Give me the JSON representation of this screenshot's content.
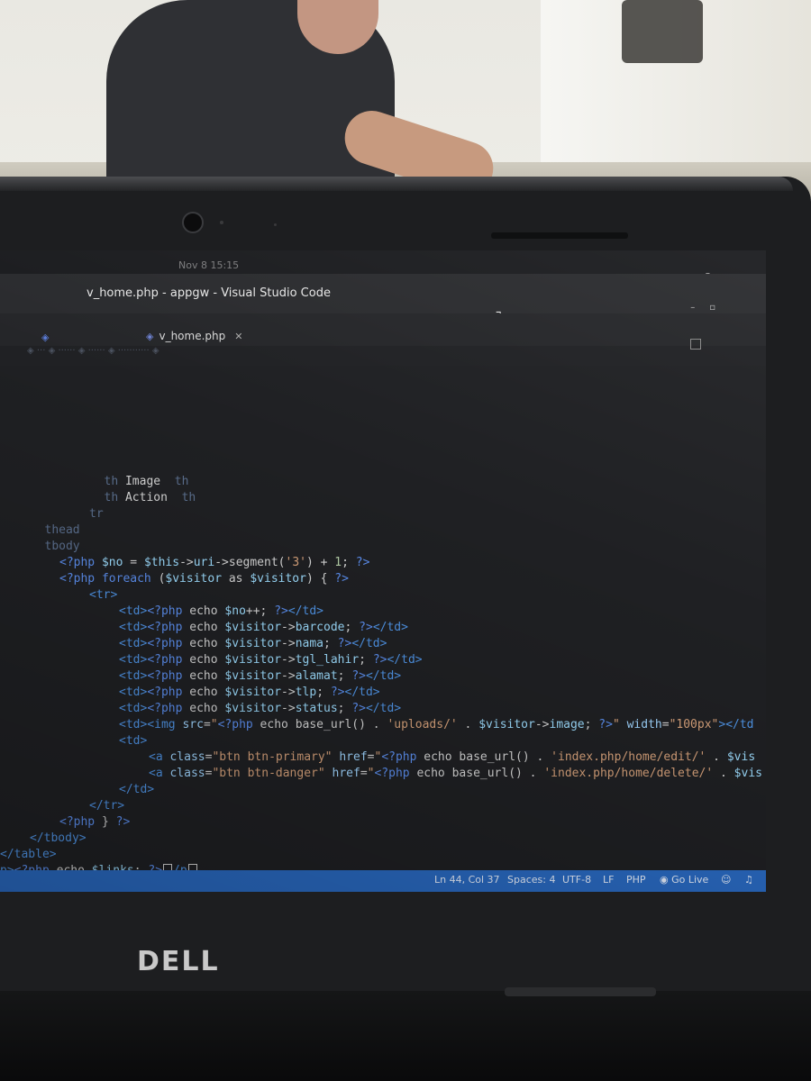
{
  "system": {
    "clock": "Nov 8  15:15",
    "tray_icons": [
      "wifi-icon",
      "volume-icon",
      "battery-icon",
      "chevron-down-icon"
    ]
  },
  "window": {
    "title": "v_home.php - appgw - Visual Studio Code",
    "controls": [
      "minimize",
      "maximize",
      "close"
    ]
  },
  "tabs": [
    {
      "label": "v_home.php",
      "icon": "php-file-icon",
      "active": true
    }
  ],
  "editor": {
    "lines": [
      {
        "indent": 7,
        "html": "<span class='t-dim'>th</span> Image  <span class='t-dim'>th</span>"
      },
      {
        "indent": 7,
        "html": "<span class='t-dim'>th</span> Action  <span class='t-dim'>th</span>"
      },
      {
        "indent": 6,
        "html": "<span class='t-dim'>tr</span>"
      },
      {
        "indent": 3,
        "html": "<span class='t-dim'>thead</span>"
      },
      {
        "indent": 3,
        "html": "<span class='t-dim'>tbody</span>"
      },
      {
        "indent": 4,
        "html": "<span class='t-php'>&lt;?php</span> <span class='t-var'>$no</span> = <span class='t-var'>$this</span>-&gt;<span class='t-var'>uri</span>-&gt;segment(<span class='t-str'>'3'</span>) + <span class='t-num'>1</span>; <span class='t-php'>?&gt;</span>"
      },
      {
        "indent": 4,
        "html": "<span class='t-php'>&lt;?php foreach</span> (<span class='t-var'>$visitor</span> as <span class='t-var'>$visitor</span>) { <span class='t-php'>?&gt;</span>"
      },
      {
        "indent": 6,
        "html": "<span class='t-tag'>&lt;tr&gt;</span>"
      },
      {
        "indent": 8,
        "html": "<span class='t-tag'>&lt;td&gt;</span><span class='t-php'>&lt;?php</span> echo <span class='t-var'>$no</span>++; <span class='t-php'>?&gt;</span><span class='t-tag'>&lt;/td&gt;</span>"
      },
      {
        "indent": 8,
        "html": "<span class='t-tag'>&lt;td&gt;</span><span class='t-php'>&lt;?php</span> echo <span class='t-var'>$visitor</span>-&gt;<span class='t-var'>barcode</span>; <span class='t-php'>?&gt;</span><span class='t-tag'>&lt;/td&gt;</span>"
      },
      {
        "indent": 8,
        "html": "<span class='t-tag'>&lt;td&gt;</span><span class='t-php'>&lt;?php</span> echo <span class='t-var'>$visitor</span>-&gt;<span class='t-var'>nama</span>; <span class='t-php'>?&gt;</span><span class='t-tag'>&lt;/td&gt;</span>"
      },
      {
        "indent": 8,
        "html": "<span class='t-tag'>&lt;td&gt;</span><span class='t-php'>&lt;?php</span> echo <span class='t-var'>$visitor</span>-&gt;<span class='t-var'>tgl_lahir</span>; <span class='t-php'>?&gt;</span><span class='t-tag'>&lt;/td&gt;</span>"
      },
      {
        "indent": 8,
        "html": "<span class='t-tag'>&lt;td&gt;</span><span class='t-php'>&lt;?php</span> echo <span class='t-var'>$visitor</span>-&gt;<span class='t-var'>alamat</span>; <span class='t-php'>?&gt;</span><span class='t-tag'>&lt;/td&gt;</span>"
      },
      {
        "indent": 8,
        "html": "<span class='t-tag'>&lt;td&gt;</span><span class='t-php'>&lt;?php</span> echo <span class='t-var'>$visitor</span>-&gt;<span class='t-var'>tlp</span>; <span class='t-php'>?&gt;</span><span class='t-tag'>&lt;/td&gt;</span>"
      },
      {
        "indent": 8,
        "html": "<span class='t-tag'>&lt;td&gt;</span><span class='t-php'>&lt;?php</span> echo <span class='t-var'>$visitor</span>-&gt;<span class='t-var'>status</span>; <span class='t-php'>?&gt;</span><span class='t-tag'>&lt;/td&gt;</span>"
      },
      {
        "indent": 8,
        "html": "<span class='t-tag'>&lt;td&gt;&lt;img</span> <span class='t-attr'>src</span>=<span class='t-str'>\"</span><span class='t-php'>&lt;?php</span> echo base_url() . <span class='t-str'>'uploads/'</span> . <span class='t-var'>$visitor</span>-&gt;<span class='t-var'>image</span>; <span class='t-php'>?&gt;</span><span class='t-str'>\"</span> <span class='t-attr'>width</span>=<span class='t-str'>\"100px\"</span><span class='t-tag'>&gt;&lt;/td</span>"
      },
      {
        "indent": 8,
        "html": "<span class='t-tag'>&lt;td&gt;</span>"
      },
      {
        "indent": 10,
        "html": "<span class='t-tag'>&lt;a</span> <span class='t-attr'>class</span>=<span class='t-str'>\"btn btn-primary\"</span> <span class='t-attr'>href</span>=<span class='t-str'>\"</span><span class='t-php'>&lt;?php</span> echo base_url() . <span class='t-str'>'index.php/home/edit/'</span> . <span class='t-var'>$vis</span>"
      },
      {
        "indent": 10,
        "html": "<span class='t-tag'>&lt;a</span> <span class='t-attr'>class</span>=<span class='t-str'>\"btn btn-danger\"</span> <span class='t-attr'>href</span>=<span class='t-str'>\"</span><span class='t-php'>&lt;?php</span> echo base_url() . <span class='t-str'>'index.php/home/delete/'</span> . <span class='t-var'>$vis</span>"
      },
      {
        "indent": 8,
        "html": "<span class='t-tag'>&lt;/td&gt;</span>"
      },
      {
        "indent": 6,
        "html": "<span class='t-tag'>&lt;/tr&gt;</span>"
      },
      {
        "indent": 4,
        "html": "<span class='t-php'>&lt;?php</span> } <span class='t-php'>?&gt;</span>"
      },
      {
        "indent": 2,
        "html": "<span class='t-tag'>&lt;/tbody&gt;</span>"
      },
      {
        "indent": 0,
        "html": "<span class='t-tag'>&lt;/table&gt;</span>"
      },
      {
        "indent": 0,
        "html": "<span class='t-tag'>p&gt;</span><span class='t-php'>&lt;?php</span> echo <span class='t-var'>$links</span>; <span class='t-php'>?&gt;</span><span class='caret'></span><span class='t-tag'>/p</span><span class='caret'></span>"
      },
      {
        "indent": 0,
        "html": "&gt;"
      }
    ]
  },
  "status_bar": {
    "position": "Ln 44, Col 37",
    "spaces": "Spaces: 4",
    "encoding": "UTF-8",
    "eol": "LF",
    "language": "PHP",
    "go_live": "Go Live"
  },
  "device": {
    "brand": "DELL"
  }
}
